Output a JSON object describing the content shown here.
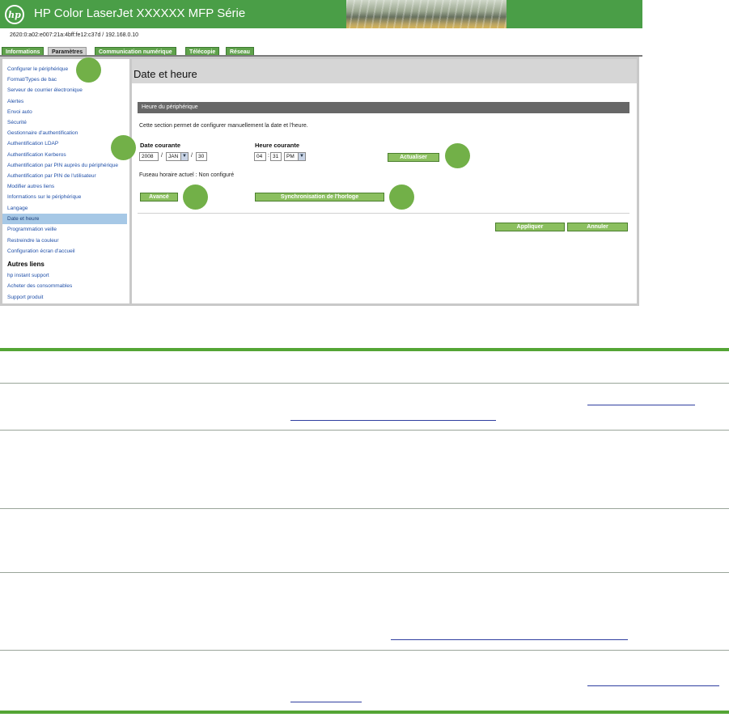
{
  "header": {
    "logo_text": "hp",
    "title": "HP Color LaserJet XXXXXX MFP Série"
  },
  "address": "2620:0:a02:e007:21a:4bff:fe12:c37d / 192.168.0.10",
  "tabs": [
    {
      "label": "Informations",
      "active": false
    },
    {
      "label": "Paramètres",
      "active": true
    },
    {
      "label": "Communication numérique",
      "active": false
    },
    {
      "label": "Télécopie",
      "active": false
    },
    {
      "label": "Réseau",
      "active": false
    }
  ],
  "sidebar": {
    "items": [
      {
        "label": "Configurer le périphérique"
      },
      {
        "label": "Format/Types de bac"
      },
      {
        "label": "Serveur de courrier électronique"
      },
      {
        "label": "Alertes"
      },
      {
        "label": "Envoi auto"
      },
      {
        "label": "Sécurité"
      },
      {
        "label": "Gestionnaire d'authentification"
      },
      {
        "label": "Authentification LDAP"
      },
      {
        "label": "Authentification Kerberos"
      },
      {
        "label": "Authentification par PIN auprès du périphérique"
      },
      {
        "label": "Authentification par PIN de l'utilisateur"
      },
      {
        "label": "Modifier autres liens"
      },
      {
        "label": "Informations sur le périphérique"
      },
      {
        "label": "Langage"
      },
      {
        "label": "Date et heure",
        "selected": true
      },
      {
        "label": "Programmation veille"
      },
      {
        "label": "Restreindre la couleur"
      },
      {
        "label": "Configuration écran d'accueil"
      }
    ],
    "other_links_heading": "Autres liens",
    "other_links": [
      {
        "label": "hp instant support"
      },
      {
        "label": "Acheter des consommables"
      },
      {
        "label": "Support produit"
      }
    ]
  },
  "main": {
    "page_title": "Date et heure",
    "section_title": "Heure du périphérique",
    "description": "Cette section permet de configurer manuellement la date et l'heure.",
    "date_label": "Date courante",
    "date_year": "2008",
    "date_month": "JAN",
    "date_day": "30",
    "date_sep": "/",
    "time_label": "Heure courante",
    "time_hour": "04",
    "time_minute": "31",
    "time_ampm": "PM",
    "time_sep": ":",
    "update_button": "Actualiser",
    "timezone_text": "Fuseau horaire actuel : Non configuré",
    "advanced_button": "Avancé",
    "sync_button": "Synchronisation de l'horloge",
    "apply_button": "Appliquer",
    "cancel_button": "Annuler"
  },
  "colors": {
    "header_green": "#4a9e47",
    "tab_green": "#5fa24b",
    "button_green": "#8bbf5f",
    "callout_green": "#72b048",
    "selected_item": "#a6c8e6",
    "section_bar": "#676767"
  }
}
